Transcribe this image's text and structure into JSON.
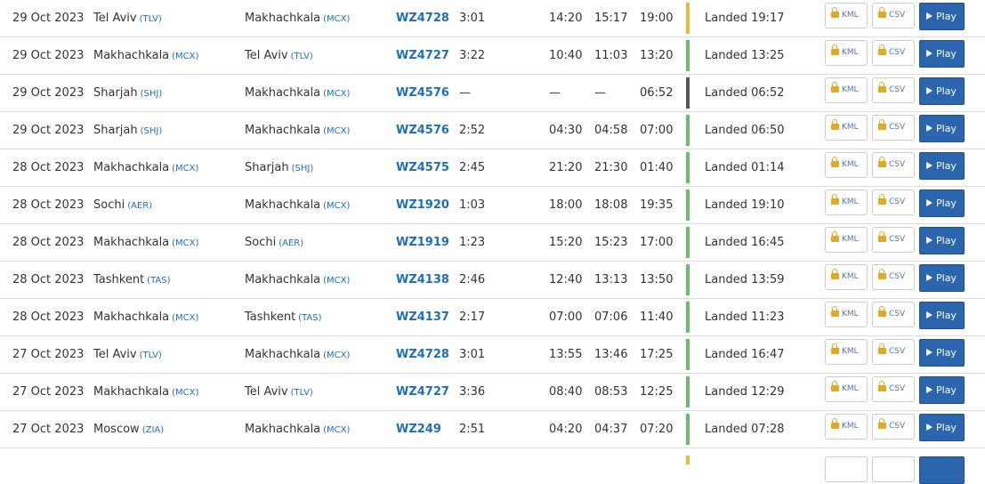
{
  "colors": {
    "landed": "#6dbb70",
    "early": "#e9ba3c",
    "unknown": "#555555",
    "link": "#1f6fb8",
    "play_bg": "#2a65ad"
  },
  "icons": {
    "lock": "lock-icon",
    "play": "play-icon"
  },
  "buttons": {
    "kml": "KML",
    "csv": "CSV",
    "play": "Play"
  },
  "flights": [
    {
      "date": "29 Oct 2023",
      "from": "Tel Aviv",
      "from_code": "(TLV)",
      "to": "Makhachkala",
      "to_code": "(MCX)",
      "flight": "WZ4728",
      "duration": "3:01",
      "std": "14:20",
      "atd": "15:17",
      "sta": "19:00",
      "status": "Landed 19:17",
      "status_color": "#e9ba3c"
    },
    {
      "date": "29 Oct 2023",
      "from": "Makhachkala",
      "from_code": "(MCX)",
      "to": "Tel Aviv",
      "to_code": "(TLV)",
      "flight": "WZ4727",
      "duration": "3:22",
      "std": "10:40",
      "atd": "11:03",
      "sta": "13:20",
      "status": "Landed 13:25",
      "status_color": "#6dbb70"
    },
    {
      "date": "29 Oct 2023",
      "from": "Sharjah",
      "from_code": "(SHJ)",
      "to": "Makhachkala",
      "to_code": "(MCX)",
      "flight": "WZ4576",
      "duration": "—",
      "std": "—",
      "atd": "—",
      "sta": "06:52",
      "status": "Landed 06:52",
      "status_color": "#555555"
    },
    {
      "date": "29 Oct 2023",
      "from": "Sharjah",
      "from_code": "(SHJ)",
      "to": "Makhachkala",
      "to_code": "(MCX)",
      "flight": "WZ4576",
      "duration": "2:52",
      "std": "04:30",
      "atd": "04:58",
      "sta": "07:00",
      "status": "Landed 06:50",
      "status_color": "#6dbb70"
    },
    {
      "date": "28 Oct 2023",
      "from": "Makhachkala",
      "from_code": "(MCX)",
      "to": "Sharjah",
      "to_code": "(SHJ)",
      "flight": "WZ4575",
      "duration": "2:45",
      "std": "21:20",
      "atd": "21:30",
      "sta": "01:40",
      "status": "Landed 01:14",
      "status_color": "#6dbb70"
    },
    {
      "date": "28 Oct 2023",
      "from": "Sochi",
      "from_code": "(AER)",
      "to": "Makhachkala",
      "to_code": "(MCX)",
      "flight": "WZ1920",
      "duration": "1:03",
      "std": "18:00",
      "atd": "18:08",
      "sta": "19:35",
      "status": "Landed 19:10",
      "status_color": "#6dbb70"
    },
    {
      "date": "28 Oct 2023",
      "from": "Makhachkala",
      "from_code": "(MCX)",
      "to": "Sochi",
      "to_code": "(AER)",
      "flight": "WZ1919",
      "duration": "1:23",
      "std": "15:20",
      "atd": "15:23",
      "sta": "17:00",
      "status": "Landed 16:45",
      "status_color": "#6dbb70"
    },
    {
      "date": "28 Oct 2023",
      "from": "Tashkent",
      "from_code": "(TAS)",
      "to": "Makhachkala",
      "to_code": "(MCX)",
      "flight": "WZ4138",
      "duration": "2:46",
      "std": "12:40",
      "atd": "13:13",
      "sta": "13:50",
      "status": "Landed 13:59",
      "status_color": "#6dbb70"
    },
    {
      "date": "28 Oct 2023",
      "from": "Makhachkala",
      "from_code": "(MCX)",
      "to": "Tashkent",
      "to_code": "(TAS)",
      "flight": "WZ4137",
      "duration": "2:17",
      "std": "07:00",
      "atd": "07:06",
      "sta": "11:40",
      "status": "Landed 11:23",
      "status_color": "#6dbb70"
    },
    {
      "date": "27 Oct 2023",
      "from": "Tel Aviv",
      "from_code": "(TLV)",
      "to": "Makhachkala",
      "to_code": "(MCX)",
      "flight": "WZ4728",
      "duration": "3:01",
      "std": "13:55",
      "atd": "13:46",
      "sta": "17:25",
      "status": "Landed 16:47",
      "status_color": "#6dbb70"
    },
    {
      "date": "27 Oct 2023",
      "from": "Makhachkala",
      "from_code": "(MCX)",
      "to": "Tel Aviv",
      "to_code": "(TLV)",
      "flight": "WZ4727",
      "duration": "3:36",
      "std": "08:40",
      "atd": "08:53",
      "sta": "12:25",
      "status": "Landed 12:29",
      "status_color": "#6dbb70"
    },
    {
      "date": "27 Oct 2023",
      "from": "Moscow",
      "from_code": "(ZIA)",
      "to": "Makhachkala",
      "to_code": "(MCX)",
      "flight": "WZ249",
      "duration": "2:51",
      "std": "04:20",
      "atd": "04:37",
      "sta": "07:20",
      "status": "Landed 07:28",
      "status_color": "#6dbb70"
    }
  ],
  "partial_row": {
    "status_color": "#e9ba3c"
  }
}
